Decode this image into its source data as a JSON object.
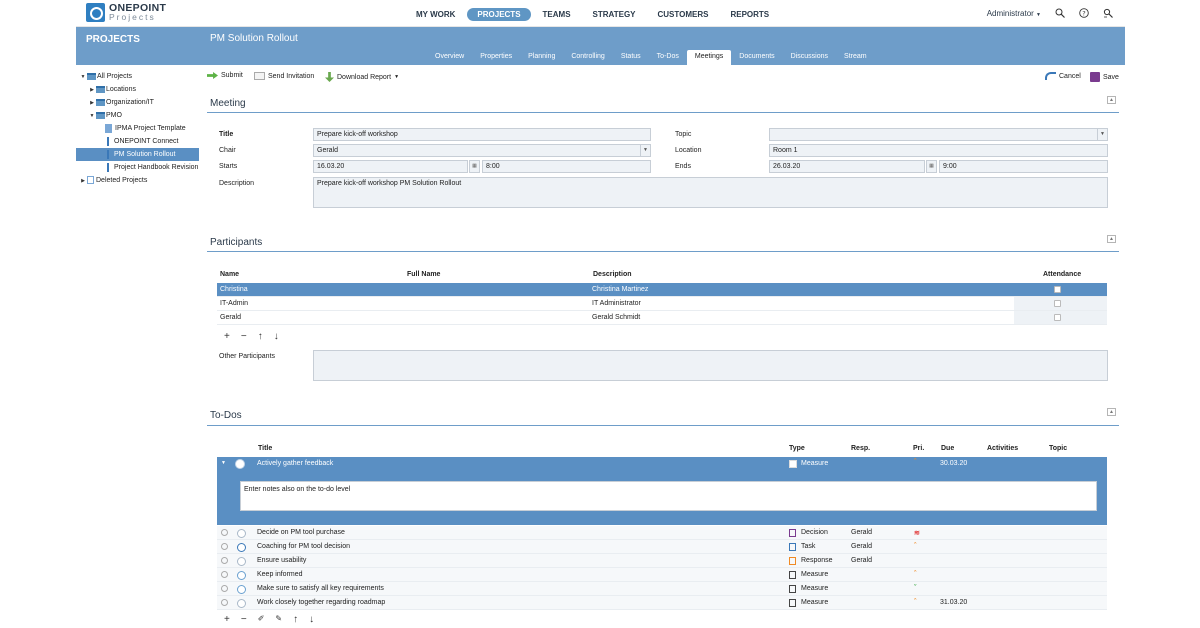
{
  "logo": {
    "name": "ONEPOINT",
    "sub": "Projects"
  },
  "nav": [
    "MY WORK",
    "PROJECTS",
    "TEAMS",
    "STRATEGY",
    "CUSTOMERS",
    "REPORTS"
  ],
  "nav_active": "PROJECTS",
  "user": "Administrator",
  "sidebar": {
    "title": "PROJECTS",
    "tree": [
      {
        "label": "All Projects",
        "arrow": "▼",
        "indent": 0,
        "icon": "folder"
      },
      {
        "label": "Locations",
        "arrow": "▶",
        "indent": 1,
        "icon": "folder"
      },
      {
        "label": "Organization/IT",
        "arrow": "▶",
        "indent": 1,
        "icon": "folder"
      },
      {
        "label": "PMO",
        "arrow": "▼",
        "indent": 1,
        "icon": "folder"
      },
      {
        "label": "IPMA Project Template",
        "arrow": "",
        "indent": 2,
        "icon": "page"
      },
      {
        "label": "ONEPOINT Connect",
        "arrow": "",
        "indent": 2,
        "icon": "bar"
      },
      {
        "label": "PM Solution Rollout",
        "arrow": "",
        "indent": 2,
        "icon": "bar",
        "selected": true
      },
      {
        "label": "Project Handbook Revision",
        "arrow": "",
        "indent": 2,
        "icon": "bar"
      },
      {
        "label": "Deleted Projects",
        "arrow": "▶",
        "indent": 0,
        "icon": "deleted"
      }
    ]
  },
  "project": {
    "title": "PM Solution Rollout"
  },
  "tabs": [
    "Overview",
    "Properties",
    "Planning",
    "Controlling",
    "Status",
    "To-Dos",
    "Meetings",
    "Documents",
    "Discussions",
    "Stream"
  ],
  "active_tab": "Meetings",
  "toolbar": {
    "submit": "Submit",
    "send_invitation": "Send Invitation",
    "download_report": "Download Report",
    "cancel": "Cancel",
    "save": "Save"
  },
  "meeting": {
    "section_title": "Meeting",
    "title_label": "Title",
    "title_value": "Prepare kick-off workshop",
    "chair_label": "Chair",
    "chair_value": "Gerald",
    "starts_label": "Starts",
    "starts_date": "16.03.20",
    "starts_time": "8:00",
    "description_label": "Description",
    "description_value": "Prepare kick-off workshop PM Solution Rollout",
    "topic_label": "Topic",
    "topic_value": "",
    "location_label": "Location",
    "location_value": "Room 1",
    "ends_label": "Ends",
    "ends_date": "26.03.20",
    "ends_time": "9:00"
  },
  "participants": {
    "section_title": "Participants",
    "columns": {
      "name": "Name",
      "full_name": "Full Name",
      "description": "Description",
      "attendance": "Attendance"
    },
    "rows": [
      {
        "name": "Christina",
        "full_name": "",
        "description": "Christina Martinez",
        "selected": true
      },
      {
        "name": "IT-Admin",
        "full_name": "",
        "description": "IT Administrator"
      },
      {
        "name": "Gerald",
        "full_name": "",
        "description": "Gerald Schmidt"
      }
    ],
    "other_label": "Other Participants",
    "other_value": ""
  },
  "todos": {
    "section_title": "To-Dos",
    "columns": {
      "title": "Title",
      "type": "Type",
      "resp": "Resp.",
      "pri": "Pri.",
      "due": "Due",
      "activities": "Activities",
      "topic": "Topic"
    },
    "selected": {
      "title": "Actively gather feedback",
      "type": "Measure",
      "resp": "",
      "due": "30.03.20",
      "notes": "Enter notes also on the to-do level"
    },
    "rows": [
      {
        "title": "Decide on PM tool purchase",
        "type": "Decision",
        "resp": "Gerald",
        "pri": "hi",
        "due": "",
        "circ": ""
      },
      {
        "title": "Coaching for PM tool decision",
        "type": "Task",
        "resp": "Gerald",
        "pri": "up",
        "due": "",
        "circ": "done"
      },
      {
        "title": "Ensure usability",
        "type": "Response",
        "resp": "Gerald",
        "pri": "",
        "due": "",
        "circ": ""
      },
      {
        "title": "Keep informed",
        "type": "Measure",
        "resp": "",
        "pri": "up",
        "due": "",
        "circ": "blue"
      },
      {
        "title": "Make sure to satisfy all key requirements",
        "type": "Measure",
        "resp": "",
        "pri": "down",
        "due": "",
        "circ": "blue"
      },
      {
        "title": "Work closely together regarding roadmap",
        "type": "Measure",
        "resp": "",
        "pri": "up",
        "due": "31.03.20",
        "circ": ""
      }
    ]
  },
  "colors": {
    "accent": "#6e9dc9",
    "selected_row": "#5a8fc3",
    "field_bg": "#eef2f6"
  }
}
